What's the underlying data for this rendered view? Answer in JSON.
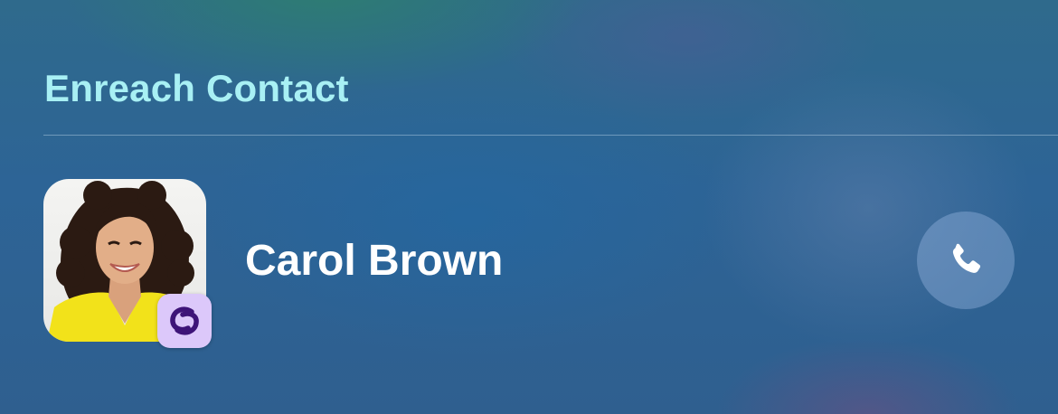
{
  "widget": {
    "title": "Enreach Contact"
  },
  "contact": {
    "name": "Carol Brown",
    "avatar_icon": "contact-photo",
    "app_badge_icon": "enreach-logo-icon",
    "call_icon": "phone-icon"
  },
  "colors": {
    "title": "#a8f0f4",
    "name": "#ffffff",
    "badge_background": "#dcc8fa",
    "badge_logo": "#3e1478"
  }
}
